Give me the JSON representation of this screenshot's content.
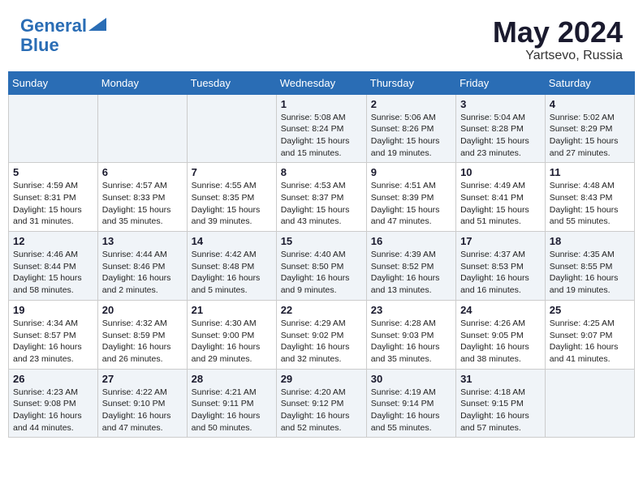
{
  "header": {
    "logo_line1": "General",
    "logo_line2": "Blue",
    "month": "May 2024",
    "location": "Yartsevo, Russia"
  },
  "weekdays": [
    "Sunday",
    "Monday",
    "Tuesday",
    "Wednesday",
    "Thursday",
    "Friday",
    "Saturday"
  ],
  "weeks": [
    [
      {
        "day": "",
        "sunrise": "",
        "sunset": "",
        "daylight": ""
      },
      {
        "day": "",
        "sunrise": "",
        "sunset": "",
        "daylight": ""
      },
      {
        "day": "",
        "sunrise": "",
        "sunset": "",
        "daylight": ""
      },
      {
        "day": "1",
        "sunrise": "Sunrise: 5:08 AM",
        "sunset": "Sunset: 8:24 PM",
        "daylight": "Daylight: 15 hours and 15 minutes."
      },
      {
        "day": "2",
        "sunrise": "Sunrise: 5:06 AM",
        "sunset": "Sunset: 8:26 PM",
        "daylight": "Daylight: 15 hours and 19 minutes."
      },
      {
        "day": "3",
        "sunrise": "Sunrise: 5:04 AM",
        "sunset": "Sunset: 8:28 PM",
        "daylight": "Daylight: 15 hours and 23 minutes."
      },
      {
        "day": "4",
        "sunrise": "Sunrise: 5:02 AM",
        "sunset": "Sunset: 8:29 PM",
        "daylight": "Daylight: 15 hours and 27 minutes."
      }
    ],
    [
      {
        "day": "5",
        "sunrise": "Sunrise: 4:59 AM",
        "sunset": "Sunset: 8:31 PM",
        "daylight": "Daylight: 15 hours and 31 minutes."
      },
      {
        "day": "6",
        "sunrise": "Sunrise: 4:57 AM",
        "sunset": "Sunset: 8:33 PM",
        "daylight": "Daylight: 15 hours and 35 minutes."
      },
      {
        "day": "7",
        "sunrise": "Sunrise: 4:55 AM",
        "sunset": "Sunset: 8:35 PM",
        "daylight": "Daylight: 15 hours and 39 minutes."
      },
      {
        "day": "8",
        "sunrise": "Sunrise: 4:53 AM",
        "sunset": "Sunset: 8:37 PM",
        "daylight": "Daylight: 15 hours and 43 minutes."
      },
      {
        "day": "9",
        "sunrise": "Sunrise: 4:51 AM",
        "sunset": "Sunset: 8:39 PM",
        "daylight": "Daylight: 15 hours and 47 minutes."
      },
      {
        "day": "10",
        "sunrise": "Sunrise: 4:49 AM",
        "sunset": "Sunset: 8:41 PM",
        "daylight": "Daylight: 15 hours and 51 minutes."
      },
      {
        "day": "11",
        "sunrise": "Sunrise: 4:48 AM",
        "sunset": "Sunset: 8:43 PM",
        "daylight": "Daylight: 15 hours and 55 minutes."
      }
    ],
    [
      {
        "day": "12",
        "sunrise": "Sunrise: 4:46 AM",
        "sunset": "Sunset: 8:44 PM",
        "daylight": "Daylight: 15 hours and 58 minutes."
      },
      {
        "day": "13",
        "sunrise": "Sunrise: 4:44 AM",
        "sunset": "Sunset: 8:46 PM",
        "daylight": "Daylight: 16 hours and 2 minutes."
      },
      {
        "day": "14",
        "sunrise": "Sunrise: 4:42 AM",
        "sunset": "Sunset: 8:48 PM",
        "daylight": "Daylight: 16 hours and 5 minutes."
      },
      {
        "day": "15",
        "sunrise": "Sunrise: 4:40 AM",
        "sunset": "Sunset: 8:50 PM",
        "daylight": "Daylight: 16 hours and 9 minutes."
      },
      {
        "day": "16",
        "sunrise": "Sunrise: 4:39 AM",
        "sunset": "Sunset: 8:52 PM",
        "daylight": "Daylight: 16 hours and 13 minutes."
      },
      {
        "day": "17",
        "sunrise": "Sunrise: 4:37 AM",
        "sunset": "Sunset: 8:53 PM",
        "daylight": "Daylight: 16 hours and 16 minutes."
      },
      {
        "day": "18",
        "sunrise": "Sunrise: 4:35 AM",
        "sunset": "Sunset: 8:55 PM",
        "daylight": "Daylight: 16 hours and 19 minutes."
      }
    ],
    [
      {
        "day": "19",
        "sunrise": "Sunrise: 4:34 AM",
        "sunset": "Sunset: 8:57 PM",
        "daylight": "Daylight: 16 hours and 23 minutes."
      },
      {
        "day": "20",
        "sunrise": "Sunrise: 4:32 AM",
        "sunset": "Sunset: 8:59 PM",
        "daylight": "Daylight: 16 hours and 26 minutes."
      },
      {
        "day": "21",
        "sunrise": "Sunrise: 4:30 AM",
        "sunset": "Sunset: 9:00 PM",
        "daylight": "Daylight: 16 hours and 29 minutes."
      },
      {
        "day": "22",
        "sunrise": "Sunrise: 4:29 AM",
        "sunset": "Sunset: 9:02 PM",
        "daylight": "Daylight: 16 hours and 32 minutes."
      },
      {
        "day": "23",
        "sunrise": "Sunrise: 4:28 AM",
        "sunset": "Sunset: 9:03 PM",
        "daylight": "Daylight: 16 hours and 35 minutes."
      },
      {
        "day": "24",
        "sunrise": "Sunrise: 4:26 AM",
        "sunset": "Sunset: 9:05 PM",
        "daylight": "Daylight: 16 hours and 38 minutes."
      },
      {
        "day": "25",
        "sunrise": "Sunrise: 4:25 AM",
        "sunset": "Sunset: 9:07 PM",
        "daylight": "Daylight: 16 hours and 41 minutes."
      }
    ],
    [
      {
        "day": "26",
        "sunrise": "Sunrise: 4:23 AM",
        "sunset": "Sunset: 9:08 PM",
        "daylight": "Daylight: 16 hours and 44 minutes."
      },
      {
        "day": "27",
        "sunrise": "Sunrise: 4:22 AM",
        "sunset": "Sunset: 9:10 PM",
        "daylight": "Daylight: 16 hours and 47 minutes."
      },
      {
        "day": "28",
        "sunrise": "Sunrise: 4:21 AM",
        "sunset": "Sunset: 9:11 PM",
        "daylight": "Daylight: 16 hours and 50 minutes."
      },
      {
        "day": "29",
        "sunrise": "Sunrise: 4:20 AM",
        "sunset": "Sunset: 9:12 PM",
        "daylight": "Daylight: 16 hours and 52 minutes."
      },
      {
        "day": "30",
        "sunrise": "Sunrise: 4:19 AM",
        "sunset": "Sunset: 9:14 PM",
        "daylight": "Daylight: 16 hours and 55 minutes."
      },
      {
        "day": "31",
        "sunrise": "Sunrise: 4:18 AM",
        "sunset": "Sunset: 9:15 PM",
        "daylight": "Daylight: 16 hours and 57 minutes."
      },
      {
        "day": "",
        "sunrise": "",
        "sunset": "",
        "daylight": ""
      }
    ]
  ]
}
